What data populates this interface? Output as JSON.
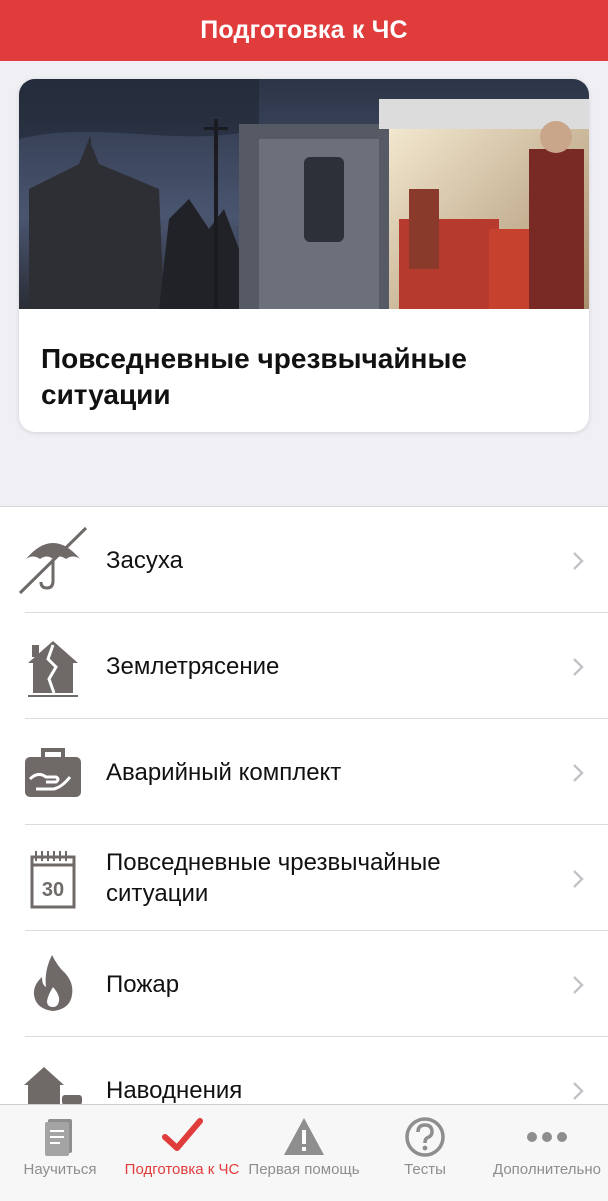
{
  "header": {
    "title": "Подготовка к ЧС"
  },
  "hero": {
    "title": "Повседневные чрезвычайные ситуации"
  },
  "list": {
    "items": [
      {
        "label": "Засуха",
        "icon": "no-umbrella-icon"
      },
      {
        "label": "Землетрясение",
        "icon": "cracked-house-icon"
      },
      {
        "label": "Аварийный комплект",
        "icon": "emergency-kit-icon"
      },
      {
        "label": "Повседневные чрезвычайные ситуации",
        "icon": "calendar-icon",
        "calendar_day": "30"
      },
      {
        "label": "Пожар",
        "icon": "fire-icon"
      },
      {
        "label": "Наводнения",
        "icon": "flood-icon"
      }
    ]
  },
  "tabbar": {
    "tabs": [
      {
        "label": "Научиться",
        "icon": "book-icon"
      },
      {
        "label": "Подготовка к ЧС",
        "icon": "checkmark-icon",
        "active": true
      },
      {
        "label": "Первая помощь",
        "icon": "warning-icon"
      },
      {
        "label": "Тесты",
        "icon": "question-icon"
      },
      {
        "label": "Дополнительно",
        "icon": "more-icon"
      }
    ]
  },
  "colors": {
    "accent": "#e03c3c",
    "icon_gray": "#6f6968",
    "chevron": "#c4c4c8",
    "tab_gray": "#8e8e8e"
  }
}
